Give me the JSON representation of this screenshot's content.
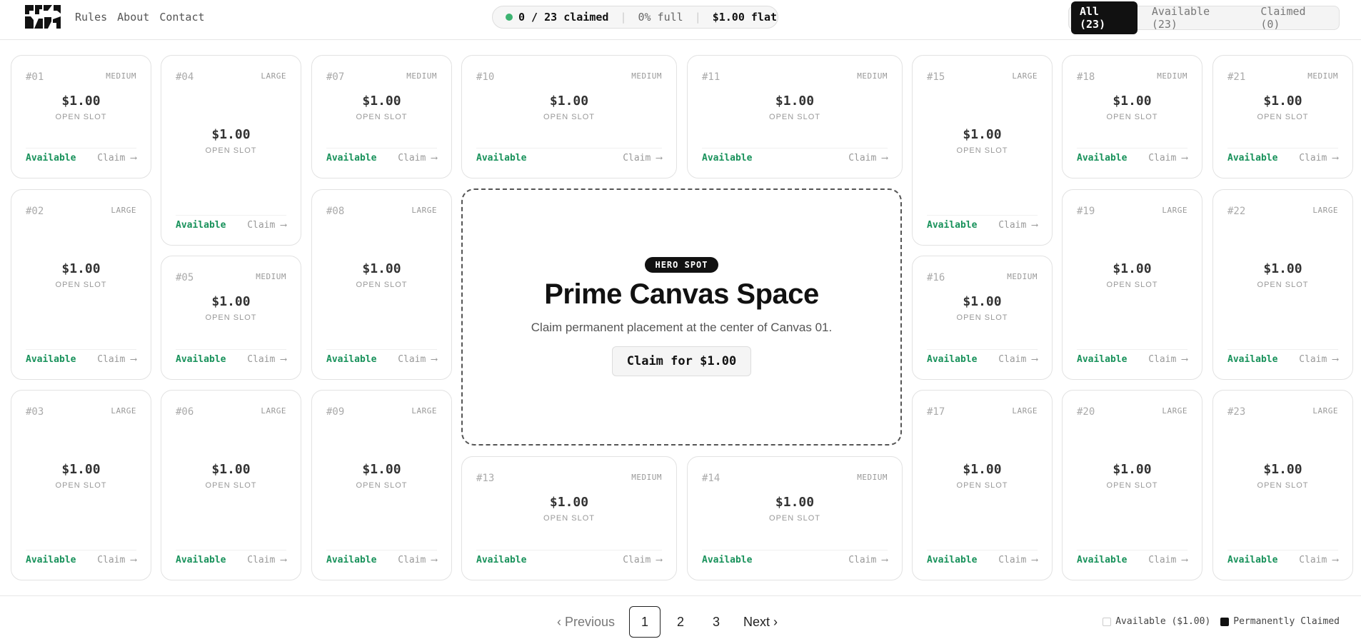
{
  "header": {
    "nav": [
      "Rules",
      "About",
      "Contact"
    ],
    "stats": {
      "claimed": "0 / 23 claimed",
      "full": "0% full",
      "flat": "$1.00 flat"
    },
    "filters": [
      "All (23)",
      "Available (23)",
      "Claimed (0)"
    ]
  },
  "cards": [
    {
      "num": "#01",
      "size": "MEDIUM",
      "price": "$1.00",
      "slot": "OPEN SLOT",
      "status": "Available",
      "claim": "Claim ⟶"
    },
    {
      "num": "#02",
      "size": "LARGE",
      "price": "$1.00",
      "slot": "OPEN SLOT",
      "status": "Available",
      "claim": "Claim ⟶"
    },
    {
      "num": "#03",
      "size": "LARGE",
      "price": "$1.00",
      "slot": "OPEN SLOT",
      "status": "Available",
      "claim": "Claim ⟶"
    },
    {
      "num": "#04",
      "size": "LARGE",
      "price": "$1.00",
      "slot": "OPEN SLOT",
      "status": "Available",
      "claim": "Claim ⟶"
    },
    {
      "num": "#05",
      "size": "MEDIUM",
      "price": "$1.00",
      "slot": "OPEN SLOT",
      "status": "Available",
      "claim": "Claim ⟶"
    },
    {
      "num": "#06",
      "size": "LARGE",
      "price": "$1.00",
      "slot": "OPEN SLOT",
      "status": "Available",
      "claim": "Claim ⟶"
    },
    {
      "num": "#07",
      "size": "MEDIUM",
      "price": "$1.00",
      "slot": "OPEN SLOT",
      "status": "Available",
      "claim": "Claim ⟶"
    },
    {
      "num": "#08",
      "size": "LARGE",
      "price": "$1.00",
      "slot": "OPEN SLOT",
      "status": "Available",
      "claim": "Claim ⟶"
    },
    {
      "num": "#09",
      "size": "LARGE",
      "price": "$1.00",
      "slot": "OPEN SLOT",
      "status": "Available",
      "claim": "Claim ⟶"
    },
    {
      "num": "#10",
      "size": "MEDIUM",
      "price": "$1.00",
      "slot": "OPEN SLOT",
      "status": "Available",
      "claim": "Claim ⟶"
    },
    {
      "num": "#11",
      "size": "MEDIUM",
      "price": "$1.00",
      "slot": "OPEN SLOT",
      "status": "Available",
      "claim": "Claim ⟶"
    },
    {
      "num": "#13",
      "size": "MEDIUM",
      "price": "$1.00",
      "slot": "OPEN SLOT",
      "status": "Available",
      "claim": "Claim ⟶"
    },
    {
      "num": "#14",
      "size": "MEDIUM",
      "price": "$1.00",
      "slot": "OPEN SLOT",
      "status": "Available",
      "claim": "Claim ⟶"
    },
    {
      "num": "#15",
      "size": "LARGE",
      "price": "$1.00",
      "slot": "OPEN SLOT",
      "status": "Available",
      "claim": "Claim ⟶"
    },
    {
      "num": "#16",
      "size": "MEDIUM",
      "price": "$1.00",
      "slot": "OPEN SLOT",
      "status": "Available",
      "claim": "Claim ⟶"
    },
    {
      "num": "#17",
      "size": "LARGE",
      "price": "$1.00",
      "slot": "OPEN SLOT",
      "status": "Available",
      "claim": "Claim ⟶"
    },
    {
      "num": "#18",
      "size": "MEDIUM",
      "price": "$1.00",
      "slot": "OPEN SLOT",
      "status": "Available",
      "claim": "Claim ⟶"
    },
    {
      "num": "#19",
      "size": "LARGE",
      "price": "$1.00",
      "slot": "OPEN SLOT",
      "status": "Available",
      "claim": "Claim ⟶"
    },
    {
      "num": "#20",
      "size": "LARGE",
      "price": "$1.00",
      "slot": "OPEN SLOT",
      "status": "Available",
      "claim": "Claim ⟶"
    },
    {
      "num": "#21",
      "size": "MEDIUM",
      "price": "$1.00",
      "slot": "OPEN SLOT",
      "status": "Available",
      "claim": "Claim ⟶"
    },
    {
      "num": "#22",
      "size": "LARGE",
      "price": "$1.00",
      "slot": "OPEN SLOT",
      "status": "Available",
      "claim": "Claim ⟶"
    },
    {
      "num": "#23",
      "size": "LARGE",
      "price": "$1.00",
      "slot": "OPEN SLOT",
      "status": "Available",
      "claim": "Claim ⟶"
    }
  ],
  "hero": {
    "badge": "HERO SPOT",
    "title": "Prime Canvas Space",
    "subtitle": "Claim permanent placement at the center of Canvas 01.",
    "button": "Claim for $1.00"
  },
  "pagination": {
    "prev": "Previous",
    "pages": [
      "1",
      "2",
      "3"
    ],
    "current": "1",
    "next": "Next"
  },
  "legend": {
    "available": "Available ($1.00)",
    "claimed": "Permanently Claimed"
  },
  "colors": {
    "available": "#17915a",
    "dark": "#111111",
    "dot": "#3cb371"
  }
}
